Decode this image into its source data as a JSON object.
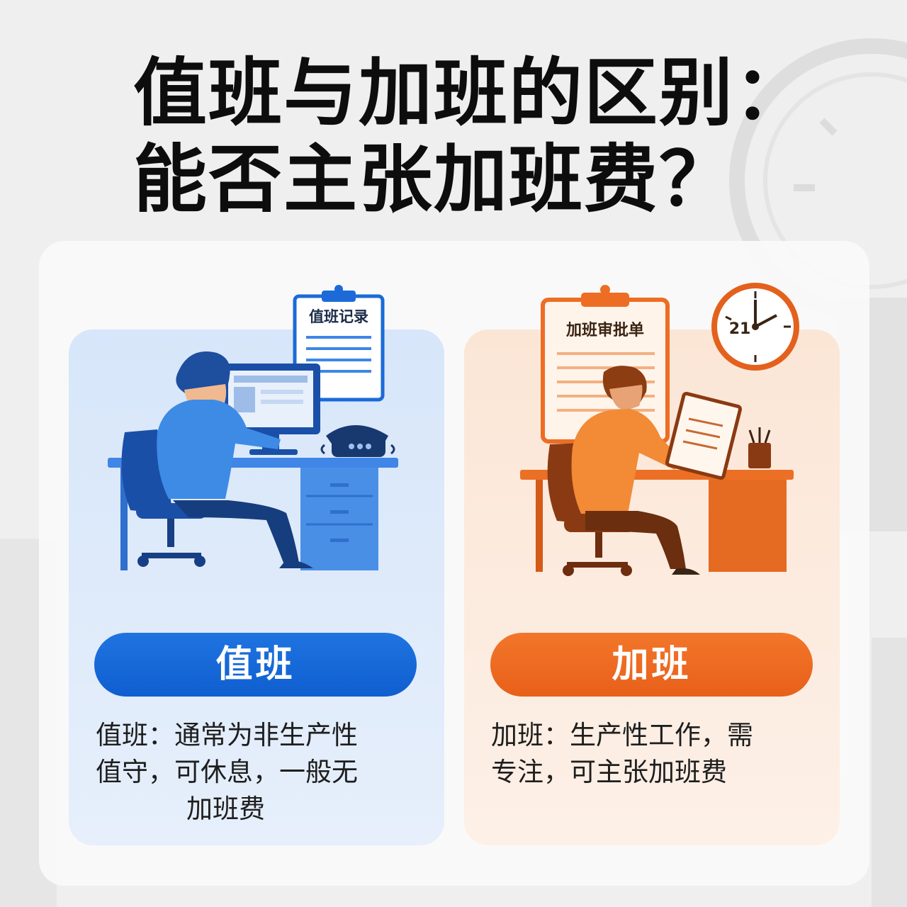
{
  "title": {
    "line1": "值班与加班的区别：",
    "line2": "能否主张加班费？"
  },
  "left": {
    "board_label": "值班记录",
    "pill": "值班",
    "desc_line1": "值班：通常为非生产性",
    "desc_line2": "值守，可休息，一般无",
    "desc_line3": "加班费",
    "colors": {
      "accent": "#1565d8",
      "card": "#dde9fa"
    }
  },
  "right": {
    "board_label": "加班审批单",
    "clock_label": "21",
    "pill": "加班",
    "desc_line1": "加班：生产性工作，需",
    "desc_line2": "专注，可主张加班费",
    "colors": {
      "accent": "#ec6a22",
      "card": "#fcebdd"
    }
  }
}
